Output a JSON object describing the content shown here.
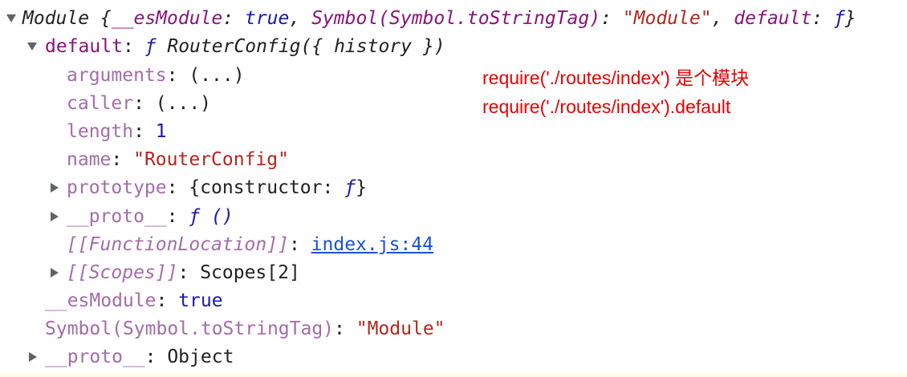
{
  "console": {
    "root": {
      "prefix": "Module {",
      "k1": "__esModule",
      "v1": "true",
      "k2": "Symbol(Symbol.toStringTag)",
      "v2": "\"Module\"",
      "k3": "default",
      "v3": "ƒ",
      "suffix": "}"
    },
    "default_row": {
      "key": "default",
      "fn_glyph": "ƒ",
      "signature": "RouterConfig({ history })"
    },
    "arguments": {
      "key": "arguments",
      "value": "(...)"
    },
    "caller": {
      "key": "caller",
      "value": "(...)"
    },
    "length": {
      "key": "length",
      "value": "1"
    },
    "name": {
      "key": "name",
      "value": "\"RouterConfig\""
    },
    "prototype": {
      "key": "prototype",
      "value": "{constructor: ",
      "fn_glyph": "ƒ",
      "close": "}"
    },
    "proto_fn": {
      "key": "__proto__",
      "value": "ƒ ()"
    },
    "function_location": {
      "key": "[[FunctionLocation]]",
      "link": "index.js:44"
    },
    "scopes": {
      "key": "[[Scopes]]",
      "value": "Scopes[2]"
    },
    "es_module": {
      "key": "__esModule",
      "value": "true"
    },
    "to_string_tag": {
      "key": "Symbol(Symbol.toStringTag)",
      "value": "\"Module\""
    },
    "proto_obj": {
      "key": "__proto__",
      "value": "Object"
    }
  },
  "annotation": {
    "line1": "require('./routes/index') 是个模块",
    "line2": "require('./routes/index').default"
  },
  "colors": {
    "annotation": "#e80000",
    "key": "#881280",
    "string": "#b3261e",
    "number": "#1a1aa6",
    "link": "#1a4fd6"
  }
}
